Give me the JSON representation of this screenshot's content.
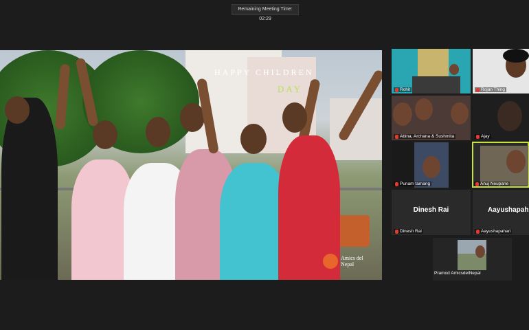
{
  "meeting": {
    "timer_text": "Remaining Meeting Time: 02:29"
  },
  "share": {
    "title_line1": "HAPPY CHILDREN",
    "title_line2": "DAY",
    "logo_text": "Amics del Nepal"
  },
  "participants": [
    {
      "name": "Rohit",
      "muted": true
    },
    {
      "name": "Rojan Thing",
      "muted": true
    },
    {
      "name": "Abina, Archana & Sushmita",
      "muted": true
    },
    {
      "name": "Ajay",
      "muted": true
    },
    {
      "name": "Punam tamang",
      "muted": true
    },
    {
      "name": "Anuj Neupane",
      "muted": true,
      "active_speaker": true
    },
    {
      "name": "Dinesh Rai",
      "muted": true,
      "display_name": "Dinesh Rai"
    },
    {
      "name": "Aayushapahari",
      "muted": true,
      "display_name": "Aayushapah"
    },
    {
      "name": "Pramod AmicsdelNepal",
      "muted": false
    }
  ],
  "colors": {
    "active_speaker_border": "#c7e23b",
    "muted_icon": "#e23a2e",
    "background": "#1c1c1c"
  }
}
